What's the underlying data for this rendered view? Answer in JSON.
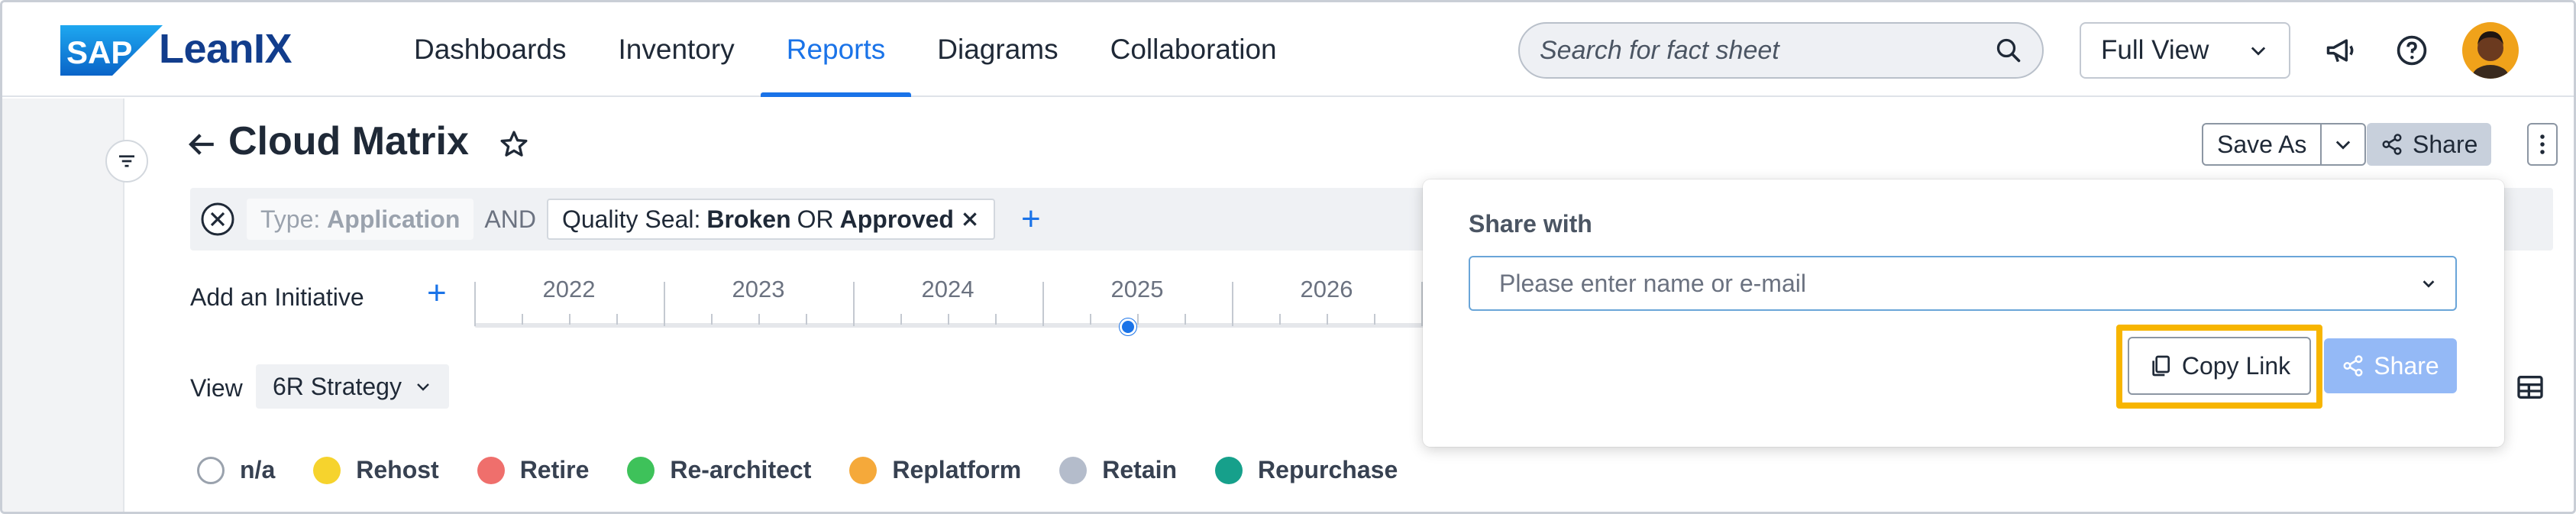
{
  "brand": {
    "logo": "SAP",
    "name": "LeanIX"
  },
  "nav": [
    {
      "label": "Dashboards",
      "active": false
    },
    {
      "label": "Inventory",
      "active": false
    },
    {
      "label": "Reports",
      "active": true
    },
    {
      "label": "Diagrams",
      "active": false
    },
    {
      "label": "Collaboration",
      "active": false
    }
  ],
  "search": {
    "placeholder": "Search for fact sheet"
  },
  "view_select": {
    "value": "Full View"
  },
  "page": {
    "title": "Cloud Matrix"
  },
  "actions": {
    "save_as": "Save As",
    "share": "Share"
  },
  "filters": {
    "type_prefix": "Type: ",
    "type_value": "Application",
    "and": "AND",
    "seal_prefix": "Quality Seal: ",
    "seal_value1": "Broken",
    "or": "OR",
    "seal_value2": "Approved"
  },
  "timeline": {
    "add_initiative": "Add an Initiative",
    "years": [
      "2022",
      "2023",
      "2024",
      "2025",
      "2026"
    ]
  },
  "view": {
    "label": "View",
    "value": "6R Strategy"
  },
  "legend": [
    {
      "label": "n/a",
      "color": "#ffffff"
    },
    {
      "label": "Rehost",
      "color": "#f6d32d"
    },
    {
      "label": "Retire",
      "color": "#ef6f6c"
    },
    {
      "label": "Re-architect",
      "color": "#3ec25a"
    },
    {
      "label": "Replatform",
      "color": "#f5a93a"
    },
    {
      "label": "Retain",
      "color": "#b4bccb"
    },
    {
      "label": "Repurchase",
      "color": "#16a08b"
    }
  ],
  "share_popover": {
    "title": "Share with",
    "placeholder": "Please enter name or e-mail",
    "copy_link": "Copy Link",
    "share": "Share"
  },
  "colors": {
    "accent": "#1a73e8",
    "brand": "#123d8c",
    "highlight": "#f7b500"
  }
}
